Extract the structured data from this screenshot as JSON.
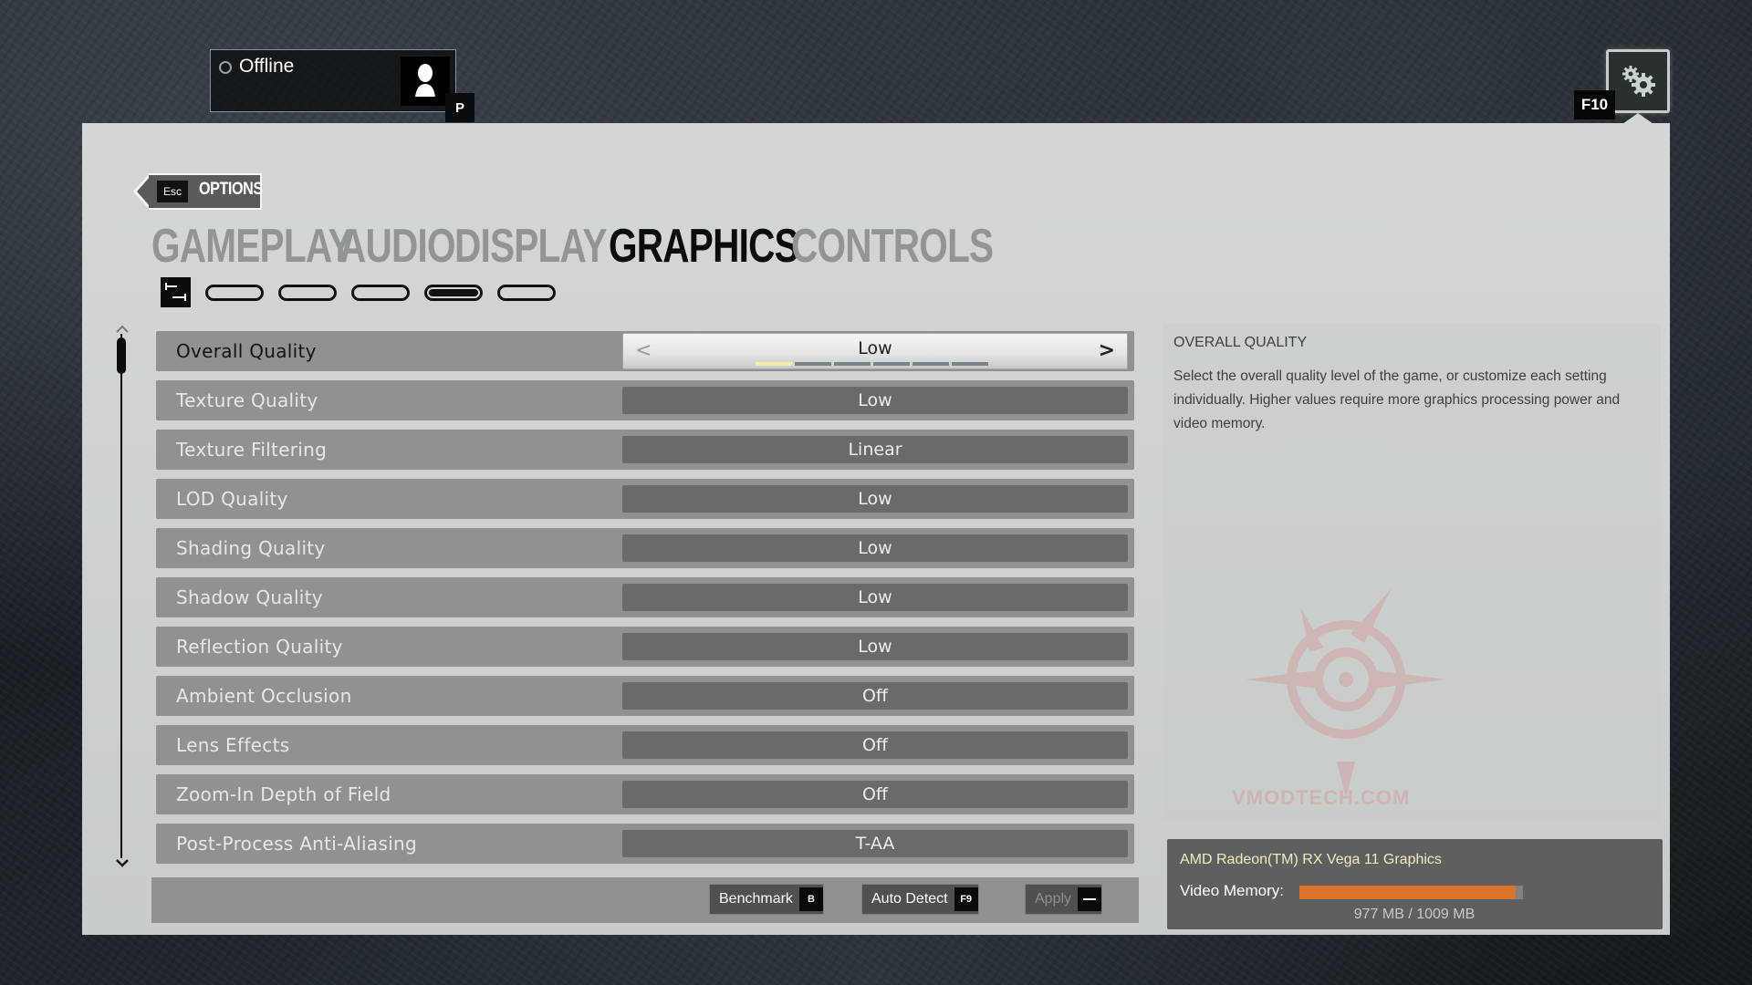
{
  "profile": {
    "status": "Offline",
    "key_hint": "P"
  },
  "settings_button": {
    "key_hint": "F10"
  },
  "back": {
    "key_hint": "Esc",
    "label": "OPTIONS"
  },
  "tabs": [
    {
      "label": "GAMEPLAY",
      "active": false
    },
    {
      "label": "AUDIO",
      "active": false
    },
    {
      "label": "DISPLAY",
      "active": false
    },
    {
      "label": "GRAPHICS",
      "active": true
    },
    {
      "label": "CONTROLS",
      "active": false
    }
  ],
  "subtab_pages": {
    "count": 5,
    "active_index": 3
  },
  "settings": [
    {
      "label": "Overall Quality",
      "value": "Low",
      "selected": true,
      "level_index": 0,
      "level_count": 6
    },
    {
      "label": "Texture Quality",
      "value": "Low"
    },
    {
      "label": "Texture Filtering",
      "value": "Linear"
    },
    {
      "label": "LOD Quality",
      "value": "Low"
    },
    {
      "label": "Shading Quality",
      "value": "Low"
    },
    {
      "label": "Shadow Quality",
      "value": "Low"
    },
    {
      "label": "Reflection Quality",
      "value": "Low"
    },
    {
      "label": "Ambient Occlusion",
      "value": "Off"
    },
    {
      "label": "Lens Effects",
      "value": "Off"
    },
    {
      "label": "Zoom-In Depth of Field",
      "value": "Off"
    },
    {
      "label": "Post-Process Anti-Aliasing",
      "value": "T-AA"
    }
  ],
  "actions": {
    "benchmark": {
      "label": "Benchmark",
      "key": "B"
    },
    "auto_detect": {
      "label": "Auto Detect",
      "key": "F9"
    },
    "apply": {
      "label": "Apply",
      "key": "",
      "disabled": true
    }
  },
  "description": {
    "title": "OVERALL QUALITY",
    "body": "Select the overall quality level of the game, or customize each setting individually. Higher values require more graphics processing power and video memory."
  },
  "watermark": "VMODTECH.COM",
  "gpu": {
    "name": "AMD Radeon(TM) RX Vega 11 Graphics",
    "memory_label": "Video Memory:",
    "memory_used_mb": 977,
    "memory_total_mb": 1009,
    "memory_text": "977 MB / 1009 MB"
  },
  "colors": {
    "memory_bar": "#d9742a",
    "active_level": "#f3eea8",
    "gpu_name": "#f2ecc0"
  }
}
